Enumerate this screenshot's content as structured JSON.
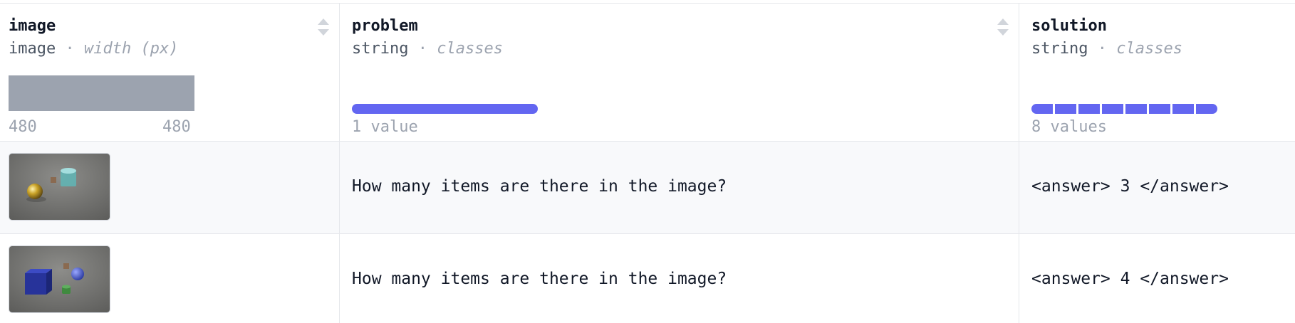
{
  "columns": [
    {
      "name": "image",
      "type": "image",
      "subtype": "width (px)",
      "range_min": "480",
      "range_max": "480"
    },
    {
      "name": "problem",
      "type": "string",
      "subtype": "classes",
      "values_label": "1 value"
    },
    {
      "name": "solution",
      "type": "string",
      "subtype": "classes",
      "values_label": "8 values"
    }
  ],
  "type_separator": "·",
  "icons": {
    "sort": "sort-updown-icon"
  },
  "colors": {
    "accent": "#6366f1",
    "histogram": "#9ca3af",
    "row_highlight": "#f8f9fb",
    "border": "#e5e7eb"
  },
  "rows": [
    {
      "image_alt": "Rendered scene with a gold sphere, a small brown cube and a cyan cylinder",
      "problem": "How many items are there in the image?",
      "solution": "<answer> 3 </answer>"
    },
    {
      "image_alt": "Rendered scene with a blue cube, a blue sphere, a small brown cube and a green cylinder",
      "problem": "How many items are there in the image?",
      "solution": "<answer> 4 </answer>"
    }
  ]
}
